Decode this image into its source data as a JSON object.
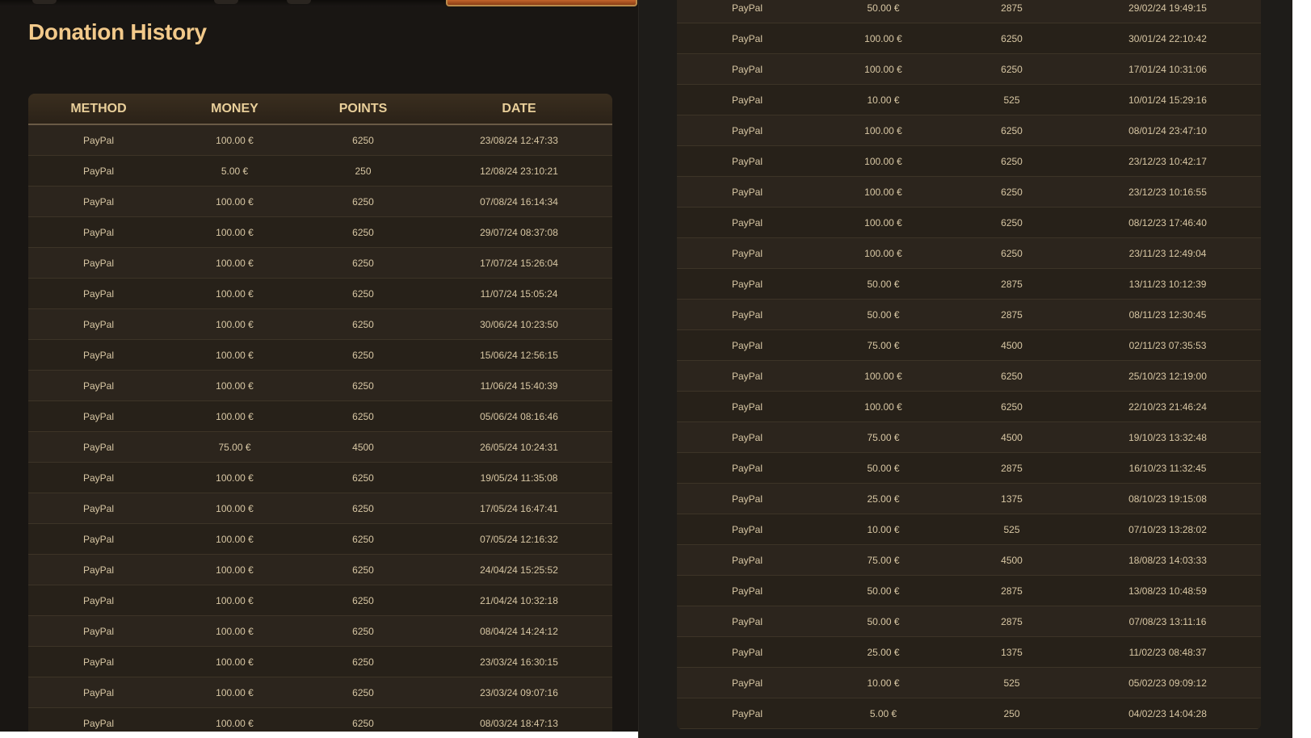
{
  "page": {
    "title": "Donation History"
  },
  "table": {
    "headers": [
      "METHOD",
      "MONEY",
      "POINTS",
      "DATE"
    ]
  },
  "left_rows": [
    [
      "PayPal",
      "100.00 €",
      "6250",
      "23/08/24 12:47:33"
    ],
    [
      "PayPal",
      "5.00 €",
      "250",
      "12/08/24 23:10:21"
    ],
    [
      "PayPal",
      "100.00 €",
      "6250",
      "07/08/24 16:14:34"
    ],
    [
      "PayPal",
      "100.00 €",
      "6250",
      "29/07/24 08:37:08"
    ],
    [
      "PayPal",
      "100.00 €",
      "6250",
      "17/07/24 15:26:04"
    ],
    [
      "PayPal",
      "100.00 €",
      "6250",
      "11/07/24 15:05:24"
    ],
    [
      "PayPal",
      "100.00 €",
      "6250",
      "30/06/24 10:23:50"
    ],
    [
      "PayPal",
      "100.00 €",
      "6250",
      "15/06/24 12:56:15"
    ],
    [
      "PayPal",
      "100.00 €",
      "6250",
      "11/06/24 15:40:39"
    ],
    [
      "PayPal",
      "100.00 €",
      "6250",
      "05/06/24 08:16:46"
    ],
    [
      "PayPal",
      "75.00 €",
      "4500",
      "26/05/24 10:24:31"
    ],
    [
      "PayPal",
      "100.00 €",
      "6250",
      "19/05/24 11:35:08"
    ],
    [
      "PayPal",
      "100.00 €",
      "6250",
      "17/05/24 16:47:41"
    ],
    [
      "PayPal",
      "100.00 €",
      "6250",
      "07/05/24 12:16:32"
    ],
    [
      "PayPal",
      "100.00 €",
      "6250",
      "24/04/24 15:25:52"
    ],
    [
      "PayPal",
      "100.00 €",
      "6250",
      "21/04/24 10:32:18"
    ],
    [
      "PayPal",
      "100.00 €",
      "6250",
      "08/04/24 14:24:12"
    ],
    [
      "PayPal",
      "100.00 €",
      "6250",
      "23/03/24 16:30:15"
    ],
    [
      "PayPal",
      "100.00 €",
      "6250",
      "23/03/24 09:07:16"
    ],
    [
      "PayPal",
      "100.00 €",
      "6250",
      "08/03/24 18:47:13"
    ]
  ],
  "right_rows": [
    [
      "PayPal",
      "50.00 €",
      "2875",
      "29/02/24 19:49:15"
    ],
    [
      "PayPal",
      "100.00 €",
      "6250",
      "30/01/24 22:10:42"
    ],
    [
      "PayPal",
      "100.00 €",
      "6250",
      "17/01/24 10:31:06"
    ],
    [
      "PayPal",
      "10.00 €",
      "525",
      "10/01/24 15:29:16"
    ],
    [
      "PayPal",
      "100.00 €",
      "6250",
      "08/01/24 23:47:10"
    ],
    [
      "PayPal",
      "100.00 €",
      "6250",
      "23/12/23 10:42:17"
    ],
    [
      "PayPal",
      "100.00 €",
      "6250",
      "23/12/23 10:16:55"
    ],
    [
      "PayPal",
      "100.00 €",
      "6250",
      "08/12/23 17:46:40"
    ],
    [
      "PayPal",
      "100.00 €",
      "6250",
      "23/11/23 12:49:04"
    ],
    [
      "PayPal",
      "50.00 €",
      "2875",
      "13/11/23 10:12:39"
    ],
    [
      "PayPal",
      "50.00 €",
      "2875",
      "08/11/23 12:30:45"
    ],
    [
      "PayPal",
      "75.00 €",
      "4500",
      "02/11/23 07:35:53"
    ],
    [
      "PayPal",
      "100.00 €",
      "6250",
      "25/10/23 12:19:00"
    ],
    [
      "PayPal",
      "100.00 €",
      "6250",
      "22/10/23 21:46:24"
    ],
    [
      "PayPal",
      "75.00 €",
      "4500",
      "19/10/23 13:32:48"
    ],
    [
      "PayPal",
      "50.00 €",
      "2875",
      "16/10/23 11:32:45"
    ],
    [
      "PayPal",
      "25.00 €",
      "1375",
      "08/10/23 19:15:08"
    ],
    [
      "PayPal",
      "10.00 €",
      "525",
      "07/10/23 13:28:02"
    ],
    [
      "PayPal",
      "75.00 €",
      "4500",
      "18/08/23 14:03:33"
    ],
    [
      "PayPal",
      "50.00 €",
      "2875",
      "13/08/23 10:48:59"
    ],
    [
      "PayPal",
      "50.00 €",
      "2875",
      "07/08/23 13:11:16"
    ],
    [
      "PayPal",
      "25.00 €",
      "1375",
      "11/02/23 08:48:37"
    ],
    [
      "PayPal",
      "10.00 €",
      "525",
      "05/02/23 09:09:12"
    ],
    [
      "PayPal",
      "5.00 €",
      "250",
      "04/02/23 14:04:28"
    ]
  ]
}
